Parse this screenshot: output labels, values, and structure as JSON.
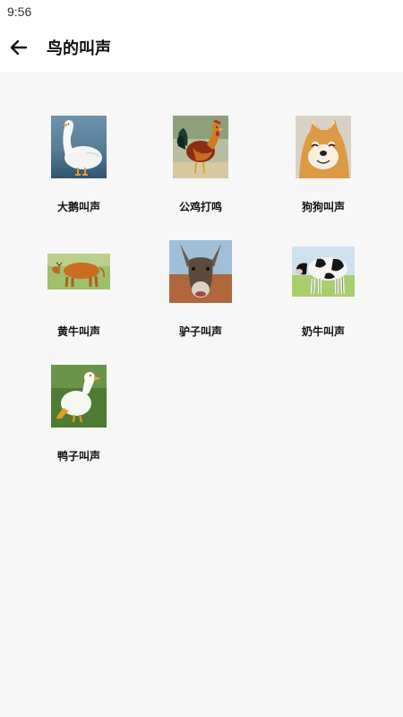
{
  "status_bar": {
    "time": "9:56"
  },
  "app_bar": {
    "title": "鸟的叫声",
    "back_icon": "arrow-back-icon"
  },
  "items": [
    {
      "label": "大鹅叫声",
      "icon": "goose"
    },
    {
      "label": "公鸡打鸣",
      "icon": "rooster"
    },
    {
      "label": "狗狗叫声",
      "icon": "dog"
    },
    {
      "label": "黄牛叫声",
      "icon": "yellow-cow"
    },
    {
      "label": "驴子叫声",
      "icon": "donkey"
    },
    {
      "label": "奶牛叫声",
      "icon": "dairy-cow"
    },
    {
      "label": "鸭子叫声",
      "icon": "duck"
    }
  ]
}
